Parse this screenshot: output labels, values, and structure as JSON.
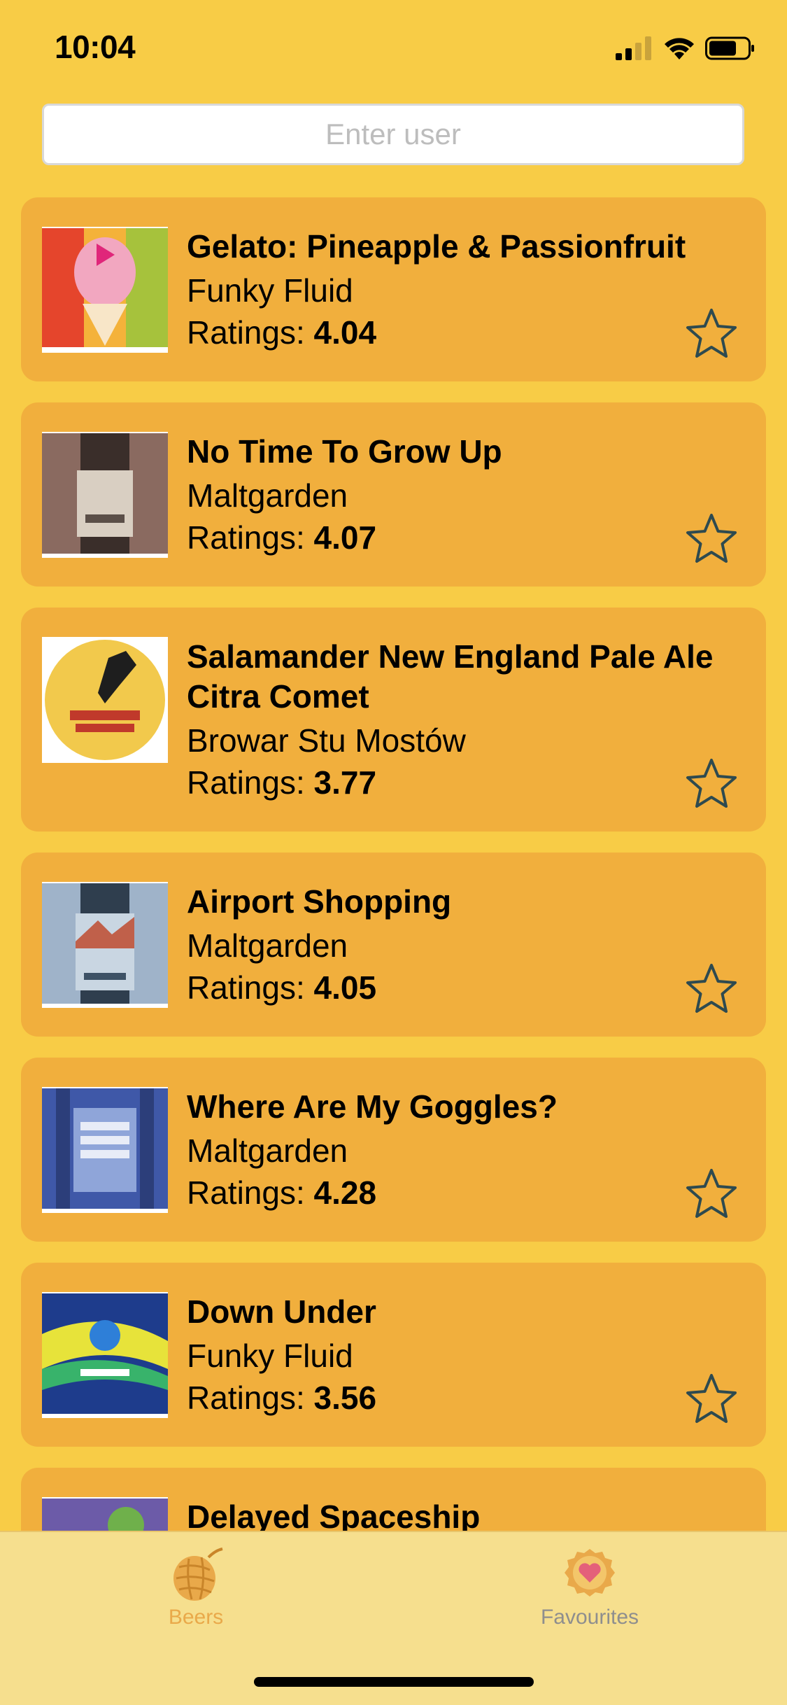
{
  "status": {
    "time": "10:04"
  },
  "search": {
    "placeholder": "Enter user",
    "value": ""
  },
  "beers": [
    {
      "name": "Gelato: Pineapple & Passionfruit",
      "brewery": "Funky Fluid",
      "rating_label": "Ratings:",
      "rating": "4.04"
    },
    {
      "name": "No Time To Grow Up",
      "brewery": "Maltgarden",
      "rating_label": "Ratings:",
      "rating": "4.07"
    },
    {
      "name": "Salamander New England Pale Ale Citra Comet",
      "brewery": "Browar Stu Mostów",
      "rating_label": "Ratings:",
      "rating": "3.77"
    },
    {
      "name": "Airport Shopping",
      "brewery": "Maltgarden",
      "rating_label": "Ratings:",
      "rating": "4.05"
    },
    {
      "name": "Where Are My Goggles?",
      "brewery": "Maltgarden",
      "rating_label": "Ratings:",
      "rating": "4.28"
    },
    {
      "name": "Down Under",
      "brewery": "Funky Fluid",
      "rating_label": "Ratings:",
      "rating": "3.56"
    },
    {
      "name": "Delayed Spaceship",
      "brewery": "",
      "rating_label": "",
      "rating": ""
    }
  ],
  "tabs": [
    {
      "label": "Beers",
      "icon": "hop-icon",
      "active": true
    },
    {
      "label": "Favourites",
      "icon": "heart-badge-icon",
      "active": false
    }
  ],
  "colors": {
    "background": "#F8CC46",
    "card": "#F1AF3D",
    "tab_bar": "#F6DF8E",
    "tab_active": "#E9A94A",
    "tab_inactive": "#8E8E8E",
    "star_stroke": "#2E4A4F"
  }
}
